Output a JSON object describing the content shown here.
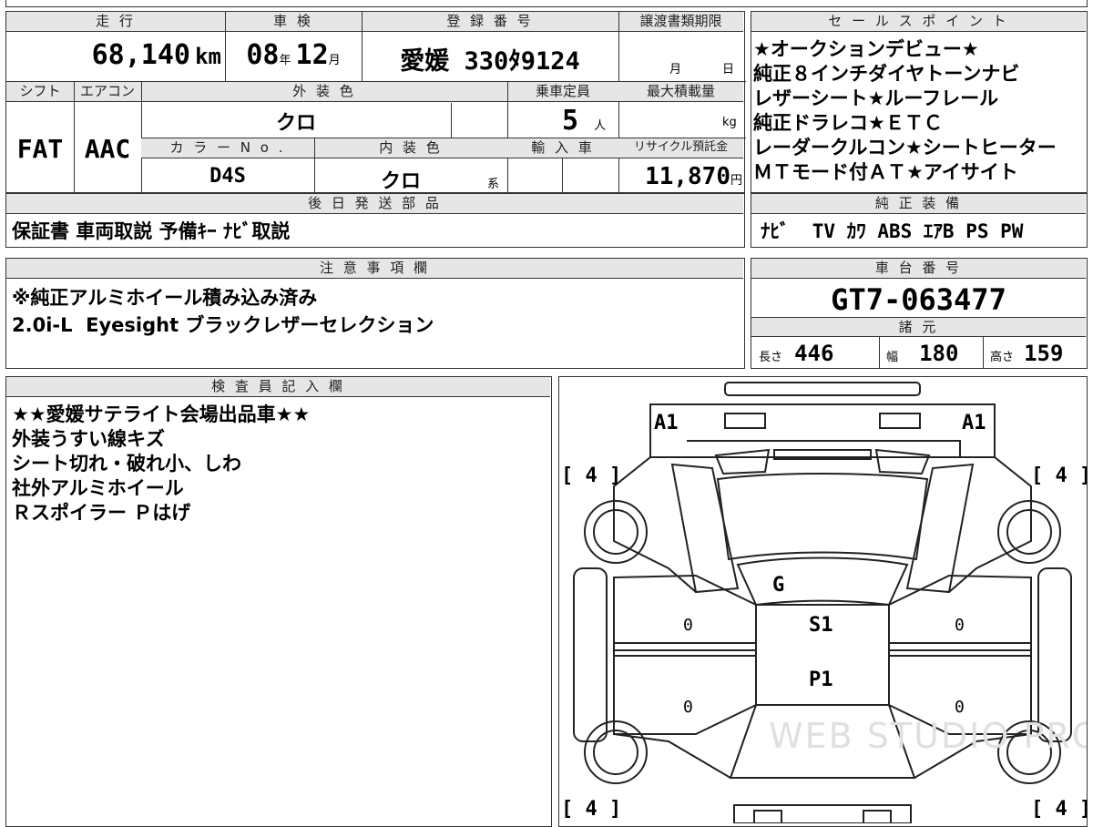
{
  "basic": {
    "mileage_label": "走 行",
    "mileage_value": "68,140",
    "mileage_unit": "km",
    "inspection_label": "車 検",
    "inspection_year": "08",
    "inspection_year_unit": "年",
    "inspection_month": "12",
    "inspection_month_unit": "月",
    "registration_label": "登 録 番 号",
    "registration_value": "愛媛 330ﾀ9124",
    "transfer_label": "譲渡書類期限",
    "transfer_month_unit": "月",
    "transfer_day_unit": "日"
  },
  "specs": {
    "shift_label": "シフト",
    "shift_value": "FAT",
    "aircon_label": "エアコン",
    "aircon_value": "AAC",
    "ext_color_label": "外 装 色",
    "ext_color_value": "クロ",
    "capacity_label": "乗車定員",
    "capacity_value": "5",
    "capacity_unit": "人",
    "max_load_label": "最大積載量",
    "max_load_unit": "kg",
    "color_no_label": "カ ラ ー N o .",
    "color_no_value": "D4S",
    "int_color_label": "内 装 色",
    "int_color_value": "クロ",
    "int_color_suffix": "系",
    "import_label": "輸 入 車",
    "recycle_label": "リサイクル預託金",
    "recycle_value": "11,870",
    "recycle_unit": "円"
  },
  "sales_points": {
    "label": "セ ー ル ス ポ イ ン ト",
    "lines": [
      "★オークションデビュー★",
      "純正８インチダイヤトーンナビ",
      "レザーシート★ルーフレール",
      "純正ドラレコ★ＥＴＣ",
      "レーダークルコン★シートヒーター",
      "ＭＴモード付ＡＴ★アイサイト"
    ]
  },
  "later_shipping": {
    "label": "後 日 発 送 部 品",
    "value": "保証書 車両取説 予備ｷｰ ﾅﾋﾞ取説"
  },
  "genuine_equipment": {
    "label": "純 正 装 備",
    "value": "ﾅﾋﾞ  TV ｶﾜ ABS ｴｱB PS PW"
  },
  "notes": {
    "label": "注 意 事 項 欄",
    "lines": [
      "※純正アルミホイール積み込み済み",
      "2.0i-L  Eyesight ブラックレザーセレクション"
    ]
  },
  "chassis": {
    "label": "車 台 番 号",
    "value": "GT7-063477"
  },
  "dimensions": {
    "label": "諸 元",
    "length_label": "長さ",
    "length_value": "446",
    "width_label": "幅",
    "width_value": "180",
    "height_label": "高さ",
    "height_value": "159"
  },
  "inspector": {
    "label": "検 査 員 記 入 欄",
    "lines": [
      "★★愛媛サテライト会場出品車★★",
      "外装うすい線キズ",
      "シート切れ・破れ小、しわ",
      "社外アルミホイール",
      "Ｒスポイラー Ｐはげ"
    ]
  },
  "diagram": {
    "mark_front_left": "A1",
    "mark_front_right": "A1",
    "tire_fl": "[ 4 ]",
    "tire_fr": "[ 4 ]",
    "tire_rl": "[ 4 ]",
    "tire_rr": "[ 4 ]",
    "mark_glass": "G",
    "mark_seat": "S1",
    "mark_paint": "P1",
    "door_fl": "0",
    "door_fr": "0",
    "door_rl": "0",
    "door_rr": "0",
    "watermark": "WEB STUDIO PRO"
  }
}
